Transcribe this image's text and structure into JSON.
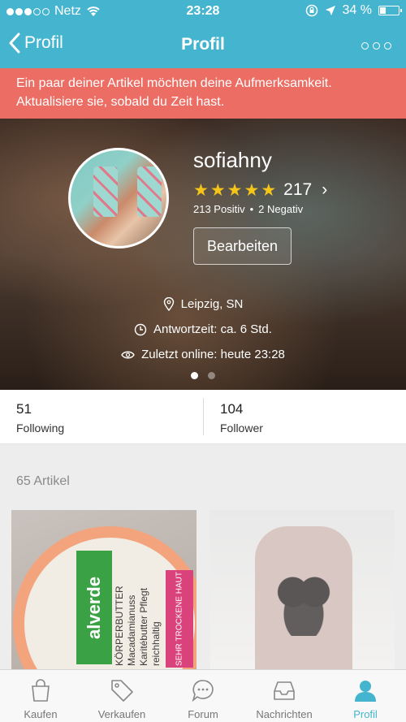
{
  "statusbar": {
    "carrier": "Netz",
    "time": "23:28",
    "battery": "34 %"
  },
  "navbar": {
    "back_label": "Profil",
    "title": "Profil"
  },
  "banner": {
    "message": "Ein paar deiner Artikel möchten deine Aufmerksamkeit. Aktualisiere sie, sobald du Zeit hast."
  },
  "profile": {
    "username": "sofiahny",
    "rating_count": "217",
    "rating_stars": 5,
    "positive": "213 Positiv",
    "negative": "2 Negativ",
    "edit_label": "Bearbeiten",
    "location": "Leipzig, SN",
    "response_time": "Antwortzeit: ca. 6 Std.",
    "last_online": "Zuletzt online: heute 23:28"
  },
  "stats": [
    {
      "value": "51",
      "label": "Following"
    },
    {
      "value": "104",
      "label": "Follower"
    }
  ],
  "articles": {
    "title": "65 Artikel",
    "product1": {
      "brand": "alverde",
      "text": "KÖRPERBUTTER Macadamianuss Karitébutter Pflegt reichhaltig",
      "badge": "SEHR TROCKENE HAUT"
    }
  },
  "tabs": [
    {
      "label": "Kaufen",
      "icon": "shopping-bag-icon"
    },
    {
      "label": "Verkaufen",
      "icon": "tag-icon"
    },
    {
      "label": "Forum",
      "icon": "chat-bubble-icon"
    },
    {
      "label": "Nachrichten",
      "icon": "inbox-icon"
    },
    {
      "label": "Profil",
      "icon": "person-icon"
    }
  ],
  "colors": {
    "accent": "#45b5cf",
    "banner": "#ec6d63",
    "star": "#f5c518"
  }
}
